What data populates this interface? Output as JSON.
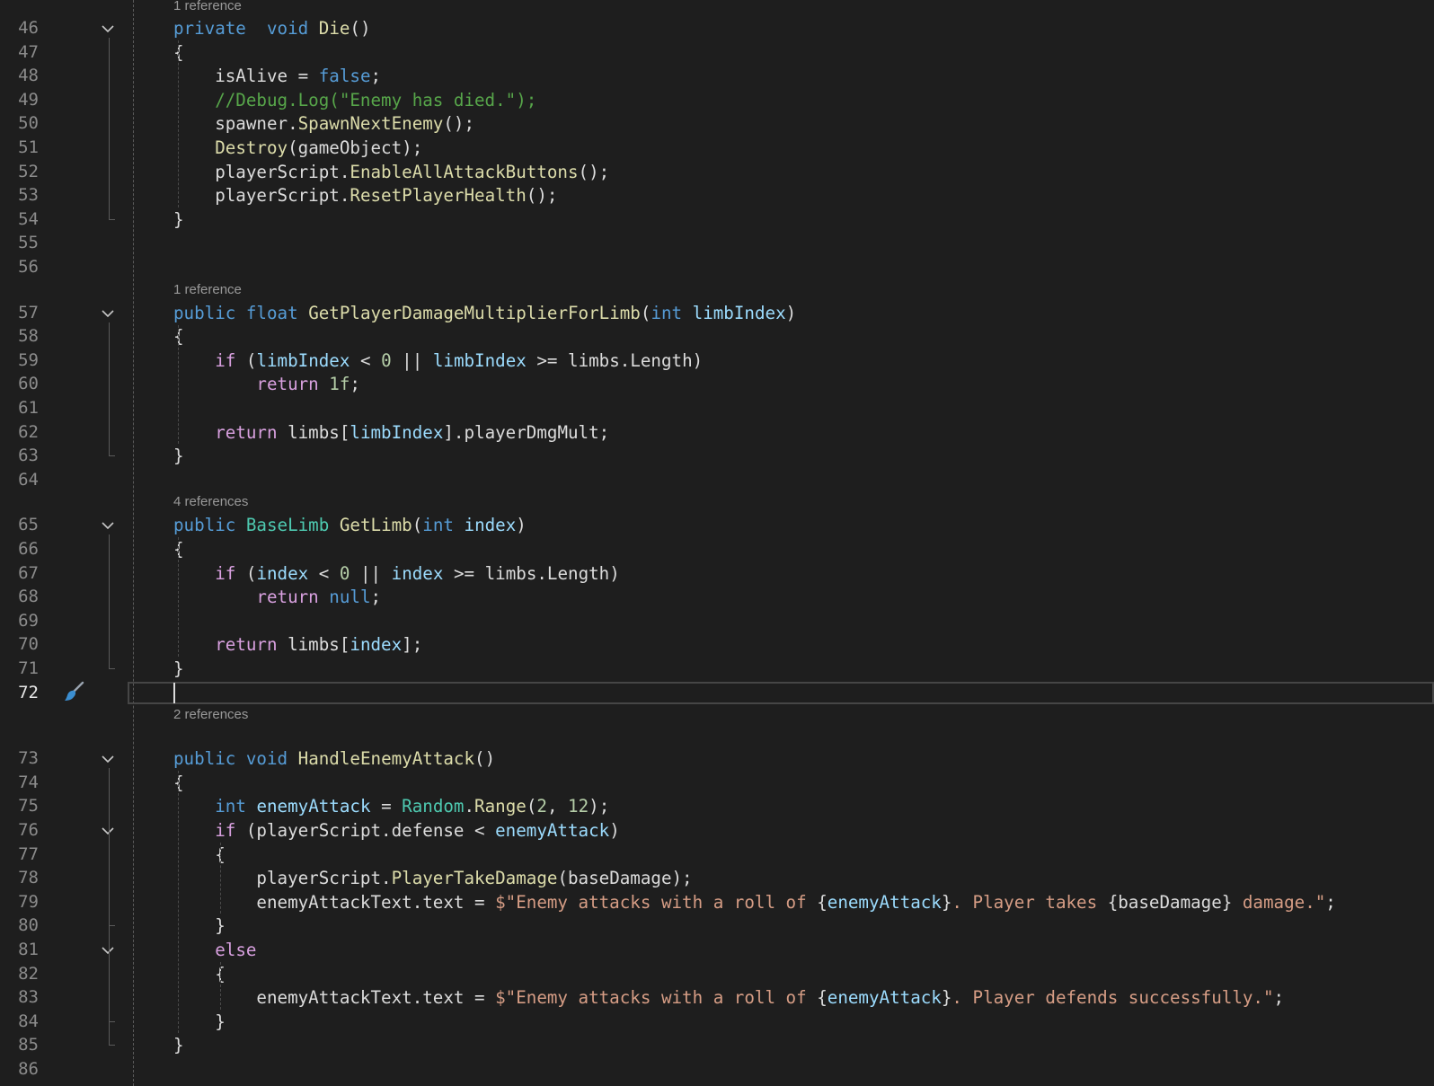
{
  "editor": {
    "lines": [
      {
        "n": 46,
        "fold": true,
        "tokens": [
          [
            "kw",
            "private"
          ],
          [
            "",
            "  "
          ],
          [
            "kw",
            "void"
          ],
          [
            "",
            " "
          ],
          [
            "fn",
            "Die"
          ],
          [
            "",
            "()"
          ]
        ]
      },
      {
        "n": 47,
        "tokens": [
          [
            "",
            "{"
          ]
        ]
      },
      {
        "n": 48,
        "tokens": [
          [
            "",
            "    isAlive = "
          ],
          [
            "kw",
            "false"
          ],
          [
            "",
            ";"
          ]
        ]
      },
      {
        "n": 49,
        "tokens": [
          [
            "cmt",
            "    //Debug.Log(\"Enemy has died.\");"
          ]
        ]
      },
      {
        "n": 50,
        "tokens": [
          [
            "",
            "    spawner."
          ],
          [
            "fn",
            "SpawnNextEnemy"
          ],
          [
            "",
            "();"
          ]
        ]
      },
      {
        "n": 51,
        "tokens": [
          [
            "",
            "    "
          ],
          [
            "fn",
            "Destroy"
          ],
          [
            "",
            "(gameObject);"
          ]
        ]
      },
      {
        "n": 52,
        "tokens": [
          [
            "",
            "    playerScript."
          ],
          [
            "fn",
            "EnableAllAttackButtons"
          ],
          [
            "",
            "();"
          ]
        ]
      },
      {
        "n": 53,
        "tokens": [
          [
            "",
            "    playerScript."
          ],
          [
            "fn",
            "ResetPlayerHealth"
          ],
          [
            "",
            "();"
          ]
        ]
      },
      {
        "n": 54,
        "tokens": [
          [
            "",
            "}"
          ]
        ]
      },
      {
        "n": 55,
        "tokens": []
      },
      {
        "n": 56,
        "tokens": []
      },
      {
        "n": 57,
        "fold": true,
        "lens": "1 reference",
        "tokens": [
          [
            "kw",
            "public"
          ],
          [
            "",
            " "
          ],
          [
            "kw",
            "float"
          ],
          [
            "",
            " "
          ],
          [
            "fn",
            "GetPlayerDamageMultiplierForLimb"
          ],
          [
            "",
            "("
          ],
          [
            "kw",
            "int"
          ],
          [
            "",
            " "
          ],
          [
            "var",
            "limbIndex"
          ],
          [
            "",
            ")"
          ]
        ]
      },
      {
        "n": 58,
        "tokens": [
          [
            "",
            "{"
          ]
        ]
      },
      {
        "n": 59,
        "tokens": [
          [
            "",
            "    "
          ],
          [
            "ctl",
            "if"
          ],
          [
            "",
            " ("
          ],
          [
            "var",
            "limbIndex"
          ],
          [
            "",
            " < "
          ],
          [
            "num",
            "0"
          ],
          [
            "",
            " || "
          ],
          [
            "var",
            "limbIndex"
          ],
          [
            "",
            " >= limbs.Length)"
          ]
        ]
      },
      {
        "n": 60,
        "tokens": [
          [
            "",
            "        "
          ],
          [
            "ctl",
            "return"
          ],
          [
            "",
            " "
          ],
          [
            "num",
            "1f"
          ],
          [
            "",
            ";"
          ]
        ]
      },
      {
        "n": 61,
        "tokens": []
      },
      {
        "n": 62,
        "tokens": [
          [
            "",
            "    "
          ],
          [
            "ctl",
            "return"
          ],
          [
            "",
            " limbs["
          ],
          [
            "var",
            "limbIndex"
          ],
          [
            "",
            "].playerDmgMult;"
          ]
        ]
      },
      {
        "n": 63,
        "tokens": [
          [
            "",
            "}"
          ]
        ]
      },
      {
        "n": 64,
        "tokens": []
      },
      {
        "n": 65,
        "fold": true,
        "lens": "4 references",
        "tokens": [
          [
            "kw",
            "public"
          ],
          [
            "",
            " "
          ],
          [
            "typ",
            "BaseLimb"
          ],
          [
            "",
            " "
          ],
          [
            "fn",
            "GetLimb"
          ],
          [
            "",
            "("
          ],
          [
            "kw",
            "int"
          ],
          [
            "",
            " "
          ],
          [
            "var",
            "index"
          ],
          [
            "",
            ")"
          ]
        ]
      },
      {
        "n": 66,
        "tokens": [
          [
            "",
            "{"
          ]
        ]
      },
      {
        "n": 67,
        "tokens": [
          [
            "",
            "    "
          ],
          [
            "ctl",
            "if"
          ],
          [
            "",
            " ("
          ],
          [
            "var",
            "index"
          ],
          [
            "",
            " < "
          ],
          [
            "num",
            "0"
          ],
          [
            "",
            " || "
          ],
          [
            "var",
            "index"
          ],
          [
            "",
            " >= limbs.Length)"
          ]
        ]
      },
      {
        "n": 68,
        "tokens": [
          [
            "",
            "        "
          ],
          [
            "ctl",
            "return"
          ],
          [
            "",
            " "
          ],
          [
            "kw",
            "null"
          ],
          [
            "",
            ";"
          ]
        ]
      },
      {
        "n": 69,
        "tokens": []
      },
      {
        "n": 70,
        "tokens": [
          [
            "",
            "    "
          ],
          [
            "ctl",
            "return"
          ],
          [
            "",
            " limbs["
          ],
          [
            "var",
            "index"
          ],
          [
            "",
            "];"
          ]
        ]
      },
      {
        "n": 71,
        "tokens": [
          [
            "",
            "}"
          ]
        ]
      },
      {
        "n": 72,
        "current": true,
        "tokens": []
      },
      {
        "n": 73,
        "fold": true,
        "lens": "2 references",
        "tokens": [
          [
            "kw",
            "public"
          ],
          [
            "",
            " "
          ],
          [
            "kw",
            "void"
          ],
          [
            "",
            " "
          ],
          [
            "fn",
            "HandleEnemyAttack"
          ],
          [
            "",
            "()"
          ]
        ]
      },
      {
        "n": 74,
        "tokens": [
          [
            "",
            "{"
          ]
        ]
      },
      {
        "n": 75,
        "tokens": [
          [
            "",
            "    "
          ],
          [
            "kw",
            "int"
          ],
          [
            "",
            " "
          ],
          [
            "var",
            "enemyAttack"
          ],
          [
            "",
            " = "
          ],
          [
            "typ",
            "Random"
          ],
          [
            "",
            "."
          ],
          [
            "fn",
            "Range"
          ],
          [
            "",
            "("
          ],
          [
            "num",
            "2"
          ],
          [
            "",
            ", "
          ],
          [
            "num",
            "12"
          ],
          [
            "",
            ");"
          ]
        ]
      },
      {
        "n": 76,
        "fold": true,
        "tokens": [
          [
            "",
            "    "
          ],
          [
            "ctl",
            "if"
          ],
          [
            "",
            " (playerScript.defense < "
          ],
          [
            "var",
            "enemyAttack"
          ],
          [
            "",
            ")"
          ]
        ]
      },
      {
        "n": 77,
        "tokens": [
          [
            "",
            "    {"
          ]
        ]
      },
      {
        "n": 78,
        "tokens": [
          [
            "",
            "        playerScript."
          ],
          [
            "fn",
            "PlayerTakeDamage"
          ],
          [
            "",
            "(baseDamage);"
          ]
        ]
      },
      {
        "n": 79,
        "tokens": [
          [
            "",
            "        enemyAttackText.text = "
          ],
          [
            "str",
            "$\"Enemy attacks with a roll of "
          ],
          [
            "",
            "{"
          ],
          [
            "var",
            "enemyAttack"
          ],
          [
            "",
            "}"
          ],
          [
            "str",
            ". Player takes "
          ],
          [
            "",
            "{baseDamage}"
          ],
          [
            "str",
            " damage.\""
          ],
          [
            "",
            ";"
          ]
        ]
      },
      {
        "n": 80,
        "tokens": [
          [
            "",
            "    }"
          ]
        ]
      },
      {
        "n": 81,
        "fold": true,
        "tokens": [
          [
            "",
            "    "
          ],
          [
            "ctl",
            "else"
          ]
        ]
      },
      {
        "n": 82,
        "tokens": [
          [
            "",
            "    {"
          ]
        ]
      },
      {
        "n": 83,
        "tokens": [
          [
            "",
            "        enemyAttackText.text = "
          ],
          [
            "str",
            "$\"Enemy attacks with a roll of "
          ],
          [
            "",
            "{"
          ],
          [
            "var",
            "enemyAttack"
          ],
          [
            "",
            "}"
          ],
          [
            "str",
            ". Player defends successfully.\""
          ],
          [
            "",
            ";"
          ]
        ]
      },
      {
        "n": 84,
        "tokens": [
          [
            "",
            "    }"
          ]
        ]
      },
      {
        "n": 85,
        "tokens": [
          [
            "",
            "}"
          ]
        ]
      },
      {
        "n": 86,
        "tokens": []
      }
    ],
    "top_lens": "1 reference",
    "icons": {
      "fold": "chevron-down-icon",
      "brush": "paintbrush-icon"
    }
  }
}
